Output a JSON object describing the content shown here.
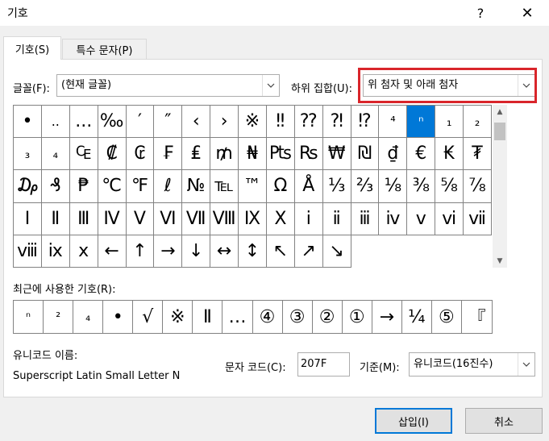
{
  "window": {
    "title": "기호",
    "help_label": "?",
    "close_label": "✕"
  },
  "tabs": [
    {
      "label": "기호(S)",
      "active": true
    },
    {
      "label": "특수 문자(P)",
      "active": false
    }
  ],
  "font": {
    "label": "글꼴(F):",
    "value": "(현재 글꼴)"
  },
  "subset": {
    "label": "하위 집합(U):",
    "value": "위 첨자 및 아래 첨자"
  },
  "symbols": [
    "•",
    "..",
    "...",
    "‰",
    "′",
    "″",
    "‹",
    "›",
    "※",
    "‼",
    "⁇",
    "⁈",
    "⁉",
    "⁴",
    "ⁿ",
    "₁",
    "₂",
    "₃",
    "₄",
    "₠",
    "₡",
    "₢",
    "₣",
    "₤",
    "₥",
    "₦",
    "₧",
    "₨",
    "₩",
    "₪",
    "₫",
    "€",
    "₭",
    "₮",
    "₯",
    "₰",
    "₱",
    "℃",
    "℉",
    "ℓ",
    "№",
    "℡",
    "™",
    "Ω",
    "Å",
    "⅓",
    "⅔",
    "⅛",
    "⅜",
    "⅝",
    "⅞",
    "Ⅰ",
    "Ⅱ",
    "Ⅲ",
    "Ⅳ",
    "Ⅴ",
    "Ⅵ",
    "Ⅶ",
    "Ⅷ",
    "Ⅸ",
    "Ⅹ",
    "ⅰ",
    "ⅱ",
    "ⅲ",
    "ⅳ",
    "ⅴ",
    "ⅵ",
    "ⅶ",
    "ⅷ",
    "ⅸ",
    "ⅹ",
    "←",
    "↑",
    "→",
    "↓",
    "↔",
    "↕",
    "↖",
    "↗",
    "↘"
  ],
  "selected_symbol": "ⁿ",
  "recent": {
    "label": "최근에 사용한 기호(R):",
    "items": [
      "ⁿ",
      "²",
      "₄",
      "•",
      "√",
      "※",
      "Ⅱ",
      "…",
      "④",
      "③",
      "②",
      "①",
      "→",
      "¼",
      "⑤",
      "『"
    ]
  },
  "unicode_name": {
    "label": "유니코드 이름:",
    "value": "Superscript Latin Small Letter N"
  },
  "char_code": {
    "label": "문자 코드(C):",
    "value": "207F"
  },
  "base": {
    "label": "기준(M):",
    "value": "유니코드(16진수)"
  },
  "buttons": {
    "insert": "삽입(I)",
    "cancel": "취소"
  }
}
